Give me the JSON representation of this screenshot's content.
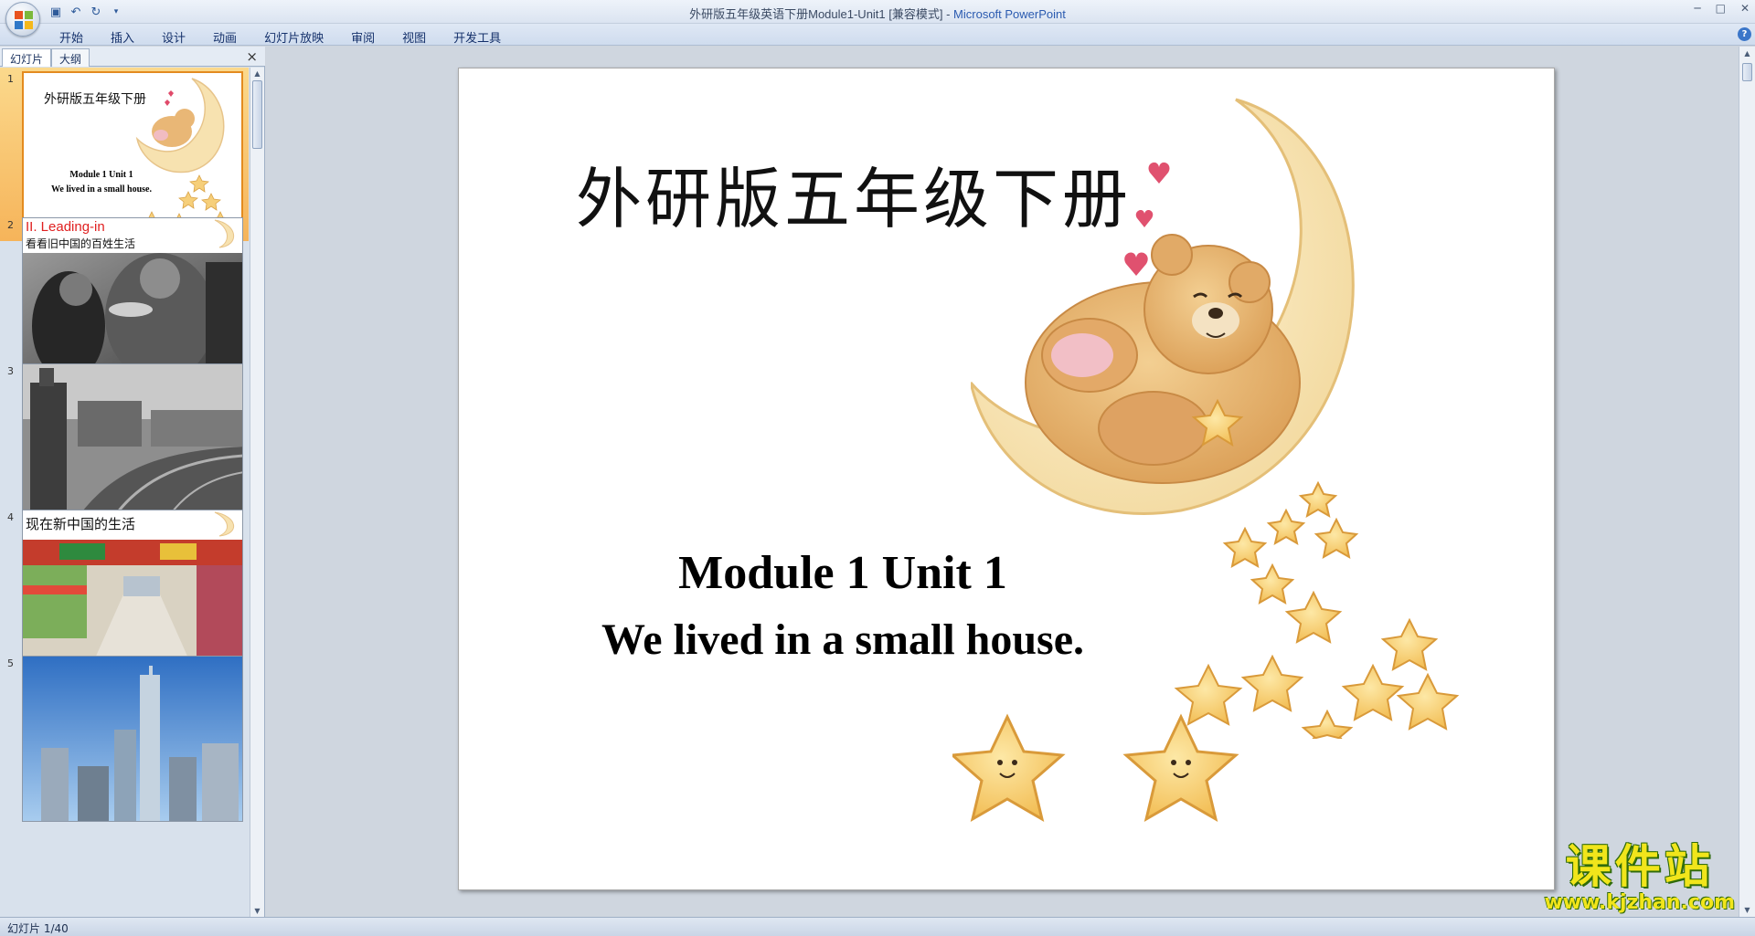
{
  "window": {
    "title_doc": "外研版五年级英语下册Module1-Unit1 [兼容模式] - ",
    "title_app": "Microsoft PowerPoint"
  },
  "ribbon": {
    "tabs": [
      "开始",
      "插入",
      "设计",
      "动画",
      "幻灯片放映",
      "审阅",
      "视图",
      "开发工具"
    ]
  },
  "panel": {
    "tab_slides": "幻灯片",
    "tab_outline": "大纲",
    "close": "×"
  },
  "thumbnails": [
    {
      "num": "1",
      "title": "外研版五年级下册",
      "line1": "Module 1 Unit 1",
      "line2": "We lived in a small house."
    },
    {
      "num": "2",
      "title": "II. Leading-in",
      "subtitle": "看看旧中国的百姓生活"
    },
    {
      "num": "3"
    },
    {
      "num": "4",
      "title": "现在新中国的生活"
    },
    {
      "num": "5"
    }
  ],
  "slide": {
    "title": "外研版五年级下册",
    "line1": "Module 1 Unit 1",
    "line2": "We lived in a small house."
  },
  "status": {
    "text": "幻灯片 1/40"
  },
  "watermark": {
    "big": "课件站",
    "small": "www.kjzhan.com"
  },
  "colors": {
    "thumb_selected": "#f6b45a",
    "leading_in_red": "#e02020",
    "watermark_yellow": "#f1e51b"
  }
}
